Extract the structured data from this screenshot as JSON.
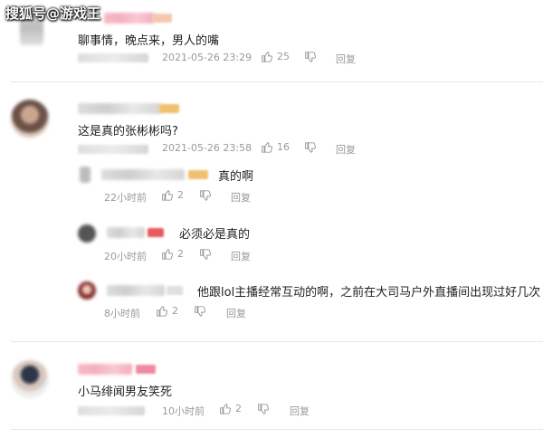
{
  "watermark": "搜狐号@游戏王",
  "like_label": "25",
  "reply_label": "回复",
  "comments": [
    {
      "text": "聊事情，晚点来，男人的嘴",
      "time": "2021-05-26 23:29",
      "likes": "25",
      "reply": "回复"
    },
    {
      "text": "这是真的张彬彬吗?",
      "time": "2021-05-26 23:58",
      "likes": "16",
      "reply": "回复",
      "replies": [
        {
          "text": "真的啊",
          "time": "22小时前",
          "likes": "2",
          "reply": "回复"
        },
        {
          "text": "必须必是真的",
          "time": "20小时前",
          "likes": "2",
          "reply": "回复"
        },
        {
          "text": "他跟lol主播经常互动的啊，之前在大司马户外直播间出现过好几次",
          "time": "8小时前",
          "likes": "2",
          "reply": "回复"
        }
      ]
    },
    {
      "text": "小马绯闻男友笑死",
      "time": "10小时前",
      "likes": "2",
      "reply": "回复"
    }
  ]
}
